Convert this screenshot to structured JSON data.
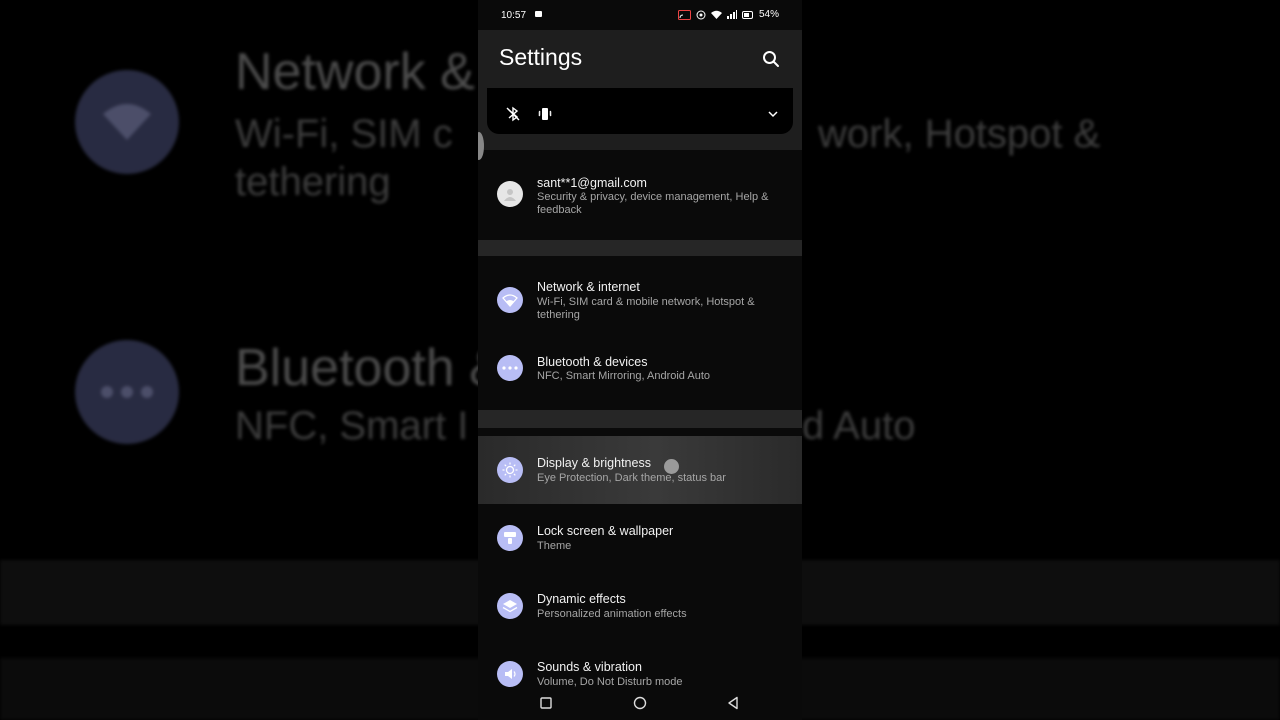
{
  "background": {
    "network_title": "Network &",
    "network_sub": "Wi-Fi, SIM card & mobile network, Hotspot & tethering",
    "network_sub_line1_left": "Wi-Fi, SIM c",
    "network_sub_line1_right": "work, Hotspot &",
    "network_sub_line2": "tethering",
    "bluetooth_title": "Bluetooth &",
    "bluetooth_sub_left": "NFC, Smart I",
    "bluetooth_sub_right": "d Auto"
  },
  "statusbar": {
    "time": "10:57",
    "battery": "54%"
  },
  "appbar": {
    "title": "Settings"
  },
  "account": {
    "email": "sant**1@gmail.com",
    "subtitle": "Security & privacy, device management, Help & feedback"
  },
  "items": [
    {
      "title": "Network & internet",
      "subtitle": "Wi-Fi, SIM card & mobile network, Hotspot & tethering",
      "icon": "wifi-icon"
    },
    {
      "title": "Bluetooth & devices",
      "subtitle": "NFC, Smart Mirroring, Android Auto",
      "icon": "more-dots-icon"
    },
    {
      "title": "Display & brightness",
      "subtitle": "Eye Protection, Dark theme, status bar",
      "icon": "brightness-icon"
    },
    {
      "title": "Lock screen & wallpaper",
      "subtitle": "Theme",
      "icon": "wallpaper-icon"
    },
    {
      "title": "Dynamic effects",
      "subtitle": "Personalized animation effects",
      "icon": "layers-icon"
    },
    {
      "title": "Sounds & vibration",
      "subtitle": "Volume, Do Not Disturb mode",
      "icon": "speaker-icon"
    }
  ],
  "colors": {
    "accent": "#b8bdf5",
    "surface": "#1e1e1e",
    "background": "#0a0a0a"
  }
}
